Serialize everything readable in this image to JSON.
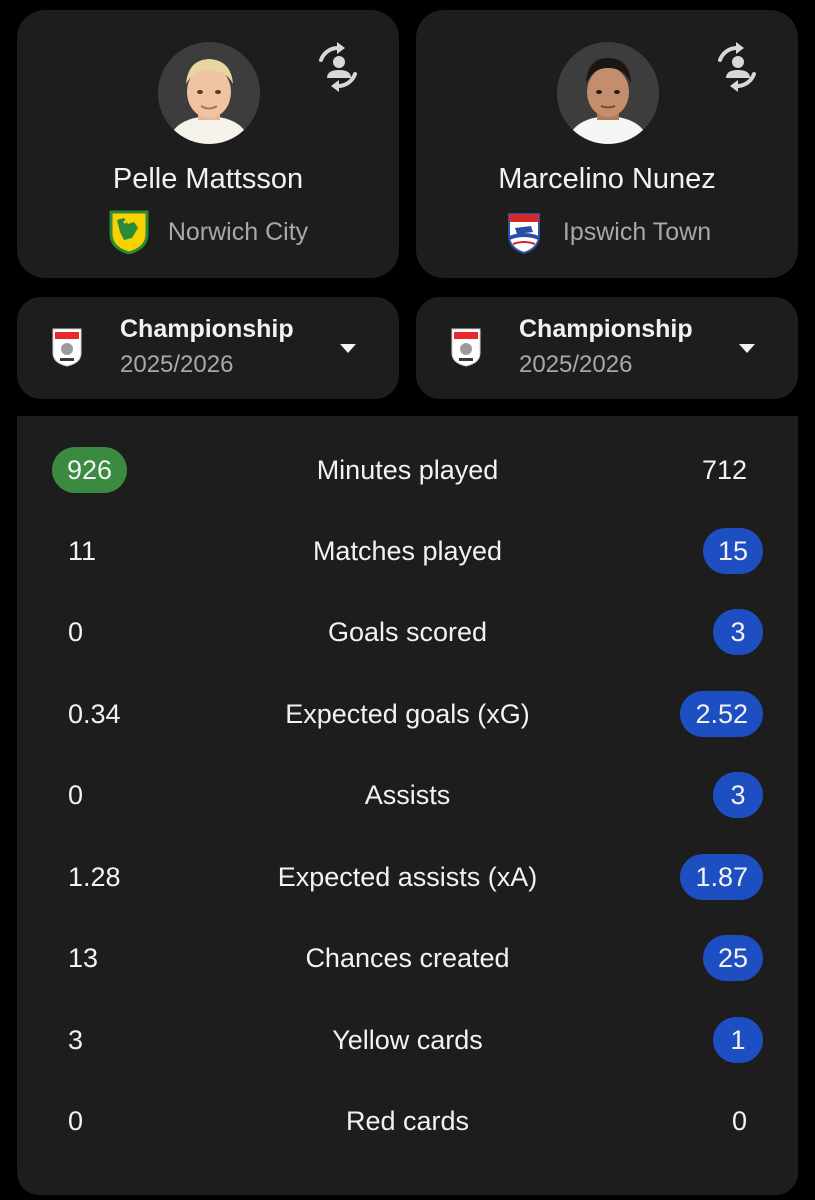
{
  "players": {
    "left": {
      "name": "Pelle Mattsson",
      "team": "Norwich City"
    },
    "right": {
      "name": "Marcelino Nunez",
      "team": "Ipswich Town"
    }
  },
  "leagues": {
    "left": {
      "name": "Championship",
      "season": "2025/2026"
    },
    "right": {
      "name": "Championship",
      "season": "2025/2026"
    }
  },
  "colors": {
    "left_highlight": "#3a8a3f",
    "right_highlight": "#1e4fc2",
    "card_background": "#1d1d1d"
  },
  "stats": [
    {
      "label": "Minutes played",
      "left": "926",
      "right": "712",
      "leader": "left"
    },
    {
      "label": "Matches played",
      "left": "11",
      "right": "15",
      "leader": "right"
    },
    {
      "label": "Goals scored",
      "left": "0",
      "right": "3",
      "leader": "right"
    },
    {
      "label": "Expected goals (xG)",
      "left": "0.34",
      "right": "2.52",
      "leader": "right"
    },
    {
      "label": "Assists",
      "left": "0",
      "right": "3",
      "leader": "right"
    },
    {
      "label": "Expected assists (xA)",
      "left": "1.28",
      "right": "1.87",
      "leader": "right"
    },
    {
      "label": "Chances created",
      "left": "13",
      "right": "25",
      "leader": "right"
    },
    {
      "label": "Yellow cards",
      "left": "3",
      "right": "1",
      "leader": "right"
    },
    {
      "label": "Red cards",
      "left": "0",
      "right": "0",
      "leader": "none"
    }
  ]
}
